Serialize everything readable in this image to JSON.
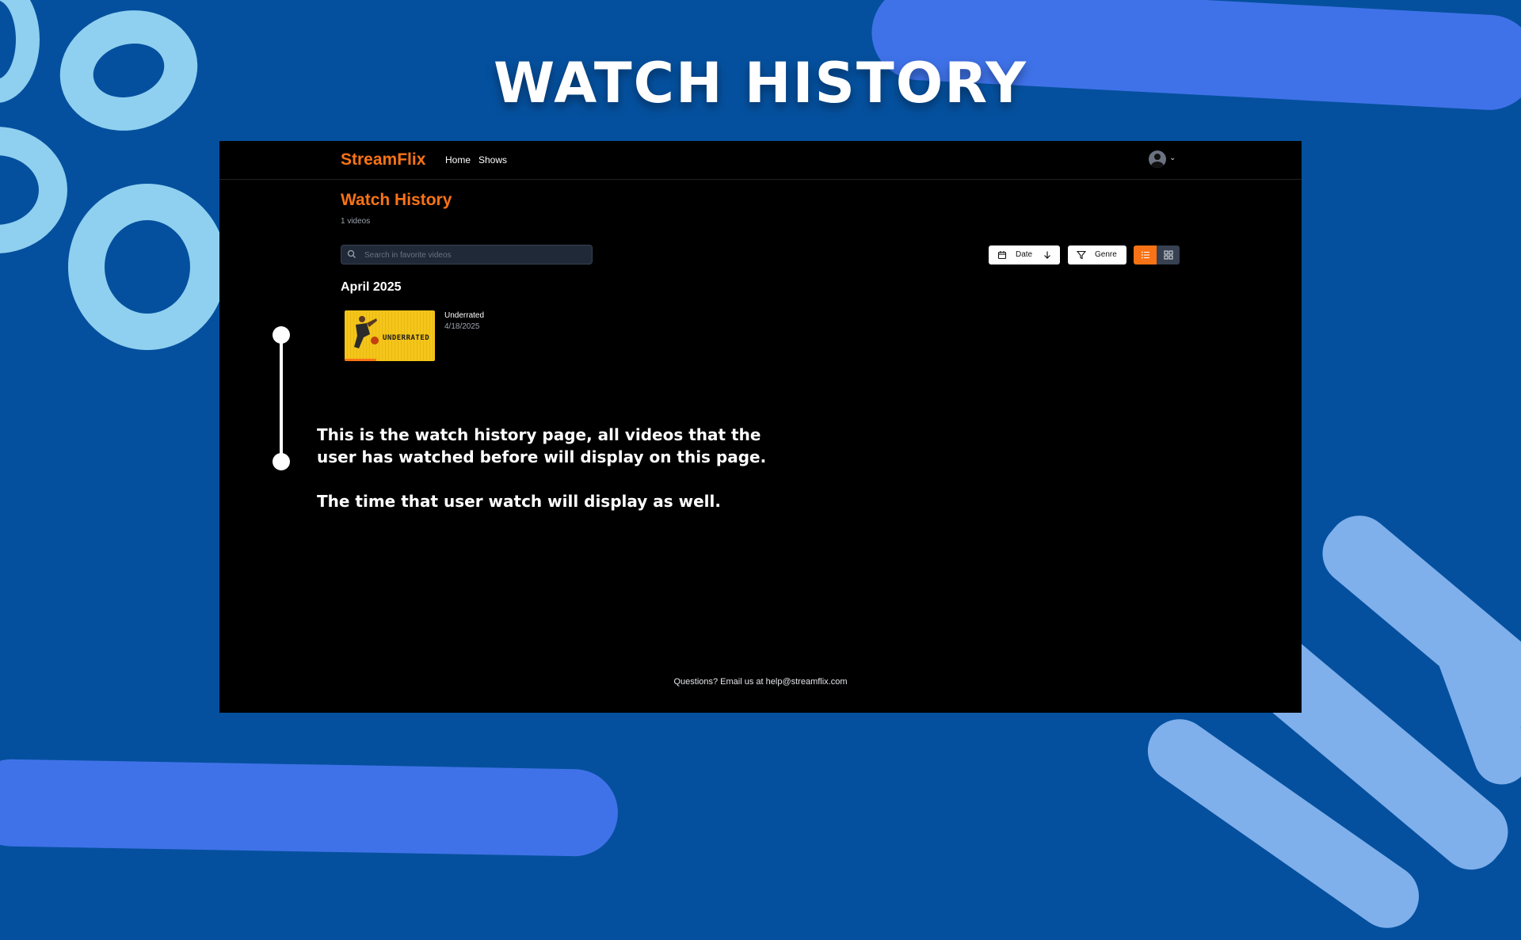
{
  "slide": {
    "title": "WATCH HISTORY"
  },
  "app": {
    "brand": "StreamFlix",
    "nav": [
      {
        "label": "Home"
      },
      {
        "label": "Shows"
      }
    ],
    "account_icon": "user-avatar-icon"
  },
  "page": {
    "title": "Watch History",
    "count": "1 videos",
    "search": {
      "placeholder": "Search in favorite videos",
      "value": ""
    },
    "sort": {
      "label": "Date",
      "icon": "calendar-icon",
      "direction_icon": "arrow-down-icon"
    },
    "filter": {
      "label": "Genre",
      "icon": "filter-icon"
    },
    "view_mode": {
      "selected": "list",
      "options": [
        "list",
        "grid"
      ]
    },
    "groups": [
      {
        "month": "April 2025",
        "videos": [
          {
            "thumbnail_text": "UNDERRATED",
            "title": "Underrated",
            "date": "4/18/2025",
            "progress": 0.35
          }
        ]
      }
    ],
    "footer": "Questions? Email us at help@streamflix.com"
  },
  "annotation": {
    "line1": "This is the watch history page, all videos that the",
    "line2": "user has watched before will display on this page.",
    "line3": "The time that user watch will display as well."
  },
  "colors": {
    "background": "#05509e",
    "accent": "#f97316",
    "screen": "#000000"
  }
}
